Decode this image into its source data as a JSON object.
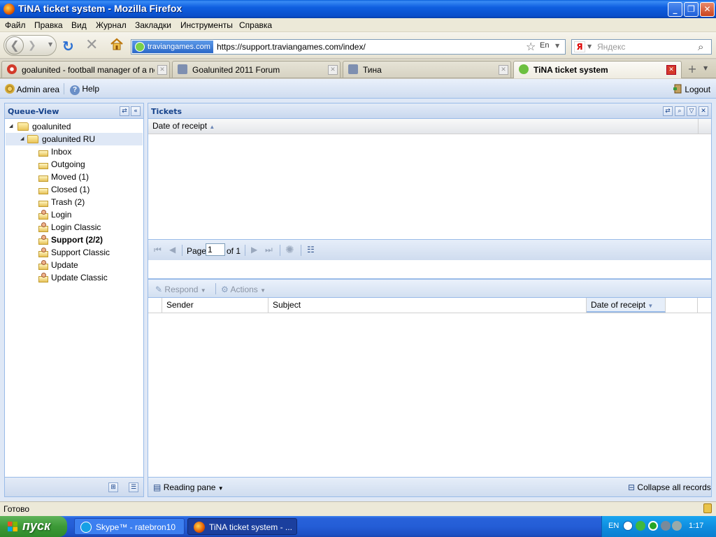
{
  "window": {
    "title": "TiNA ticket system - Mozilla Firefox"
  },
  "menu": [
    "Файл",
    "Правка",
    "Вид",
    "Журнал",
    "Закладки",
    "Инструменты",
    "Справка"
  ],
  "urlbar": {
    "site_badge": "traviangames.com",
    "url": "https://support.traviangames.com/index/",
    "lang_badge": "En"
  },
  "search": {
    "placeholder": "Яндекс",
    "engine_letter": "Я"
  },
  "tabs": [
    {
      "label": "goalunited - football manager of a ne...",
      "active": false
    },
    {
      "label": "Goalunited 2011 Forum",
      "active": false
    },
    {
      "label": "Тина",
      "active": false
    },
    {
      "label": "TiNA ticket system",
      "active": true
    }
  ],
  "app": {
    "admin_area": "Admin area",
    "help": "Help",
    "logout": "Logout"
  },
  "queue_view": {
    "title": "Queue-View",
    "root": "goalunited",
    "sub": "goalunited RU",
    "items": [
      {
        "label": "Inbox",
        "bold": false,
        "icon": "inbox-icon"
      },
      {
        "label": "Outgoing",
        "bold": false,
        "icon": "outgoing-icon"
      },
      {
        "label": "Moved  (1)",
        "bold": false,
        "icon": "moved-icon"
      },
      {
        "label": "Closed  (1)",
        "bold": false,
        "icon": "closed-icon"
      },
      {
        "label": "Trash  (2)",
        "bold": false,
        "icon": "trash-icon"
      },
      {
        "label": "Login",
        "bold": false,
        "icon": "user-queue-icon"
      },
      {
        "label": "Login Classic",
        "bold": false,
        "icon": "user-queue-icon"
      },
      {
        "label": "Support  (2/2)",
        "bold": true,
        "icon": "user-queue-icon"
      },
      {
        "label": "Support Classic",
        "bold": false,
        "icon": "user-queue-icon"
      },
      {
        "label": "Update",
        "bold": false,
        "icon": "user-queue-icon"
      },
      {
        "label": "Update Classic",
        "bold": false,
        "icon": "user-queue-icon"
      }
    ]
  },
  "tickets": {
    "title": "Tickets",
    "column": "Date of receipt",
    "pager": {
      "page_label": "Page",
      "page_value": "1",
      "of_label": "of 1"
    }
  },
  "detail": {
    "respond": "Respond",
    "actions": "Actions",
    "columns": [
      "Sender",
      "Subject",
      "Date of receipt"
    ],
    "reading_pane": "Reading pane",
    "collapse_all": "Collapse all records"
  },
  "status": {
    "text": "Готово"
  },
  "taskbar": {
    "start": "пуск",
    "tasks": [
      {
        "label": "Skype™ - ratebron10",
        "active": false
      },
      {
        "label": "TiNA ticket system - ...",
        "active": true
      }
    ],
    "lang": "EN",
    "clock": "1:17"
  },
  "colors": {
    "panel_border": "#99bbe8",
    "panel_title": "#15428b",
    "xp_blue": "#245dd6"
  }
}
